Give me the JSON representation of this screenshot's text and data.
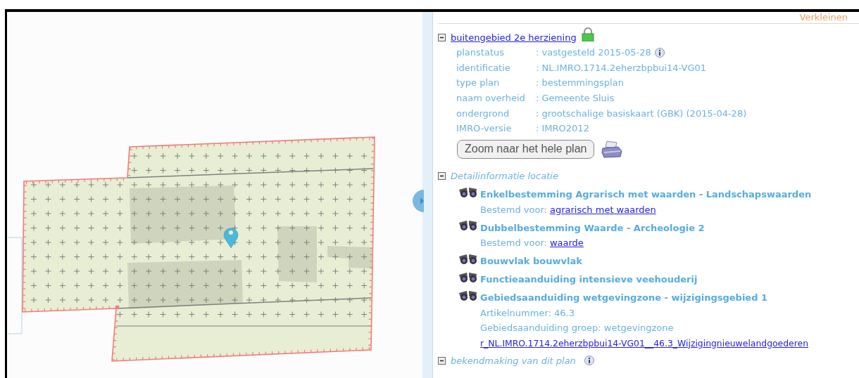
{
  "panel": {
    "zoom_out_link": "Verkleinen",
    "plan": {
      "title": "buitengebied 2e herziening",
      "expanded": true,
      "locked": true,
      "properties": [
        {
          "label": "planstatus",
          "value": ": vastgesteld 2015-05-28",
          "info": true
        },
        {
          "label": "identificatie",
          "value": ": NL.IMRO.1714.2eherzbpbui14-VG01",
          "info": false
        },
        {
          "label": "type plan",
          "value": ": bestemmingsplan",
          "info": false
        },
        {
          "label": "naam overheid",
          "value": ": Gemeente Sluis",
          "info": false
        },
        {
          "label": "ondergrond",
          "value": ": grootschalige basiskaart (GBK) (2015-04-28)",
          "info": false
        },
        {
          "label": "IMRO-versie",
          "value": ": IMRO2012",
          "info": false
        }
      ],
      "zoom_button": "Zoom naar het hele plan"
    },
    "detail": {
      "title": "Detailinformatie locatie",
      "expanded": true,
      "items": [
        {
          "title": "Enkelbestemming Agrarisch met waarden - Landschapswaarden",
          "lines": [
            {
              "kind": "labeled_link",
              "label": "Bestemd voor:",
              "text": "agrarisch met waarden"
            }
          ]
        },
        {
          "title": "Dubbelbestemming Waarde - Archeologie 2",
          "lines": [
            {
              "kind": "labeled_link",
              "label": "Bestemd voor:",
              "text": "waarde"
            }
          ]
        },
        {
          "title": "Bouwvlak bouwvlak"
        },
        {
          "title": "Functieaanduiding intensieve veehouderij"
        },
        {
          "title": "Gebiedsaanduiding wetgevingzone - wijzigingsgebied 1",
          "lines": [
            {
              "kind": "text",
              "text": "Artikelnummer: 46.3"
            },
            {
              "kind": "text",
              "text": "Gebiedsaanduiding groep: wetgevingzone"
            },
            {
              "kind": "link",
              "text": "r_NL.IMRO.1714.2eherzbpbui14-VG01__46.3_Wijzigingnieuwelandgoederen"
            }
          ]
        }
      ]
    },
    "announcement": {
      "title": "bekendmaking van dit plan",
      "expanded": true,
      "info": true
    }
  }
}
